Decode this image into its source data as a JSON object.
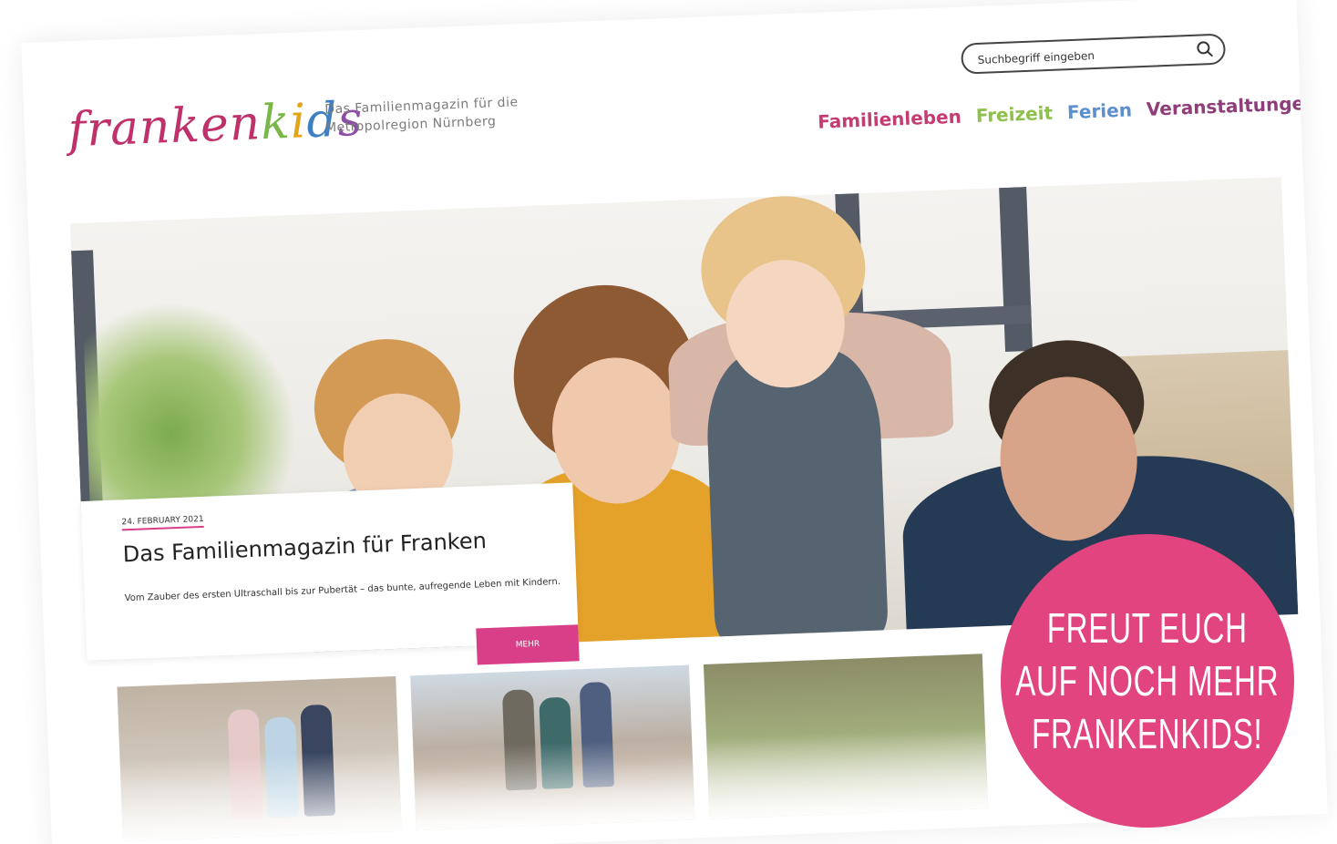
{
  "header": {
    "logo_text": "frankenkids",
    "tagline_line1": "Das Familienmagazin für die",
    "tagline_line2": "Metropolregion Nürnberg"
  },
  "search": {
    "placeholder": "Suchbegriff eingeben",
    "icon": "search-icon"
  },
  "nav": {
    "items": [
      {
        "label": "Familienleben",
        "color": "#c23d73"
      },
      {
        "label": "Freizeit",
        "color": "#8ec04b"
      },
      {
        "label": "Ferien",
        "color": "#5b8fcf"
      },
      {
        "label": "Veranstaltungen",
        "color": "#8e3d7a"
      }
    ]
  },
  "article": {
    "date": "24. FEBRUARY 2021",
    "title": "Das Familienmagazin für Franken",
    "description": "Vom Zauber des ersten Ultraschall bis zur Pubertät – das bunte, aufregende Leben mit Kindern.",
    "button_label": "MEHR"
  },
  "badge": {
    "line1": "FREUT EUCH",
    "line2": "AUF NOCH MEHR",
    "line3": "FRANKENKIDS!",
    "color": "#e2447f"
  },
  "colors": {
    "accent": "#d93e88"
  }
}
